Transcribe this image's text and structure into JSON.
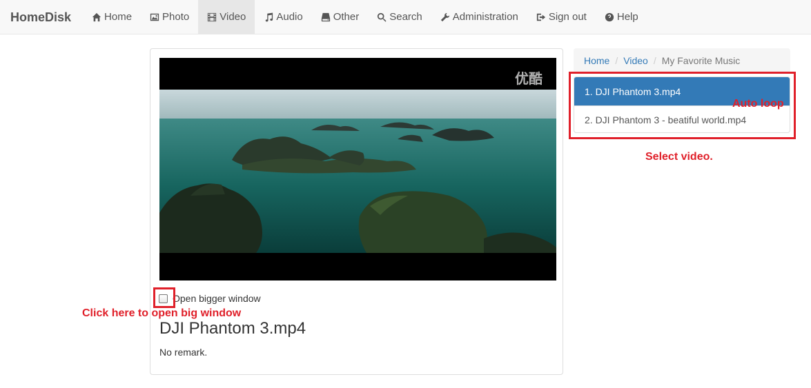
{
  "navbar": {
    "brand": "HomeDisk",
    "items": [
      {
        "label": "Home",
        "icon": "home-icon"
      },
      {
        "label": "Photo",
        "icon": "picture-icon"
      },
      {
        "label": "Video",
        "icon": "film-icon",
        "active": true
      },
      {
        "label": "Audio",
        "icon": "music-icon"
      },
      {
        "label": "Other",
        "icon": "hdd-icon"
      },
      {
        "label": "Search",
        "icon": "search-icon"
      },
      {
        "label": "Administration",
        "icon": "wrench-icon"
      },
      {
        "label": "Sign out",
        "icon": "sign-out-icon"
      },
      {
        "label": "Help",
        "icon": "question-icon"
      }
    ]
  },
  "player": {
    "watermark": "优酷",
    "open_bigger_label": "Open bigger window",
    "title": "DJI Phantom 3.mp4",
    "remark": "No remark."
  },
  "breadcrumb": {
    "home": "Home",
    "video": "Video",
    "current": "My Favorite Music"
  },
  "playlist": [
    {
      "label": "1. DJI Phantom 3.mp4",
      "active": true
    },
    {
      "label": "2. DJI Phantom 3 - beatiful world.mp4",
      "active": false
    }
  ],
  "annotations": {
    "auto_loop": "Auto loop",
    "select_video": "Select video.",
    "open_big": "Click here to open big window"
  },
  "colors": {
    "accent": "#337ab7",
    "annotation": "#e0202a"
  }
}
